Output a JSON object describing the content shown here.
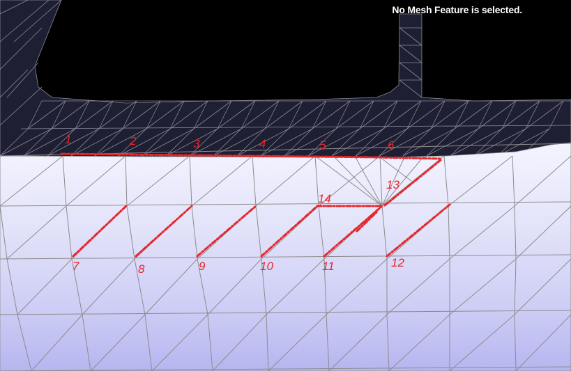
{
  "status": {
    "message": "No Mesh Feature is selected."
  },
  "colors": {
    "background": "#000000",
    "dark_mesh_fill": "#1f1f33",
    "dark_mesh_edge": "#8a8a9a",
    "light_mesh_edge": "#8c8c8c",
    "annotation": "#e8262c"
  },
  "annotations": {
    "labels": [
      "1",
      "2",
      "3",
      "4",
      "5",
      "6",
      "7",
      "8",
      "9",
      "10",
      "11",
      "12",
      "13",
      "14"
    ]
  }
}
